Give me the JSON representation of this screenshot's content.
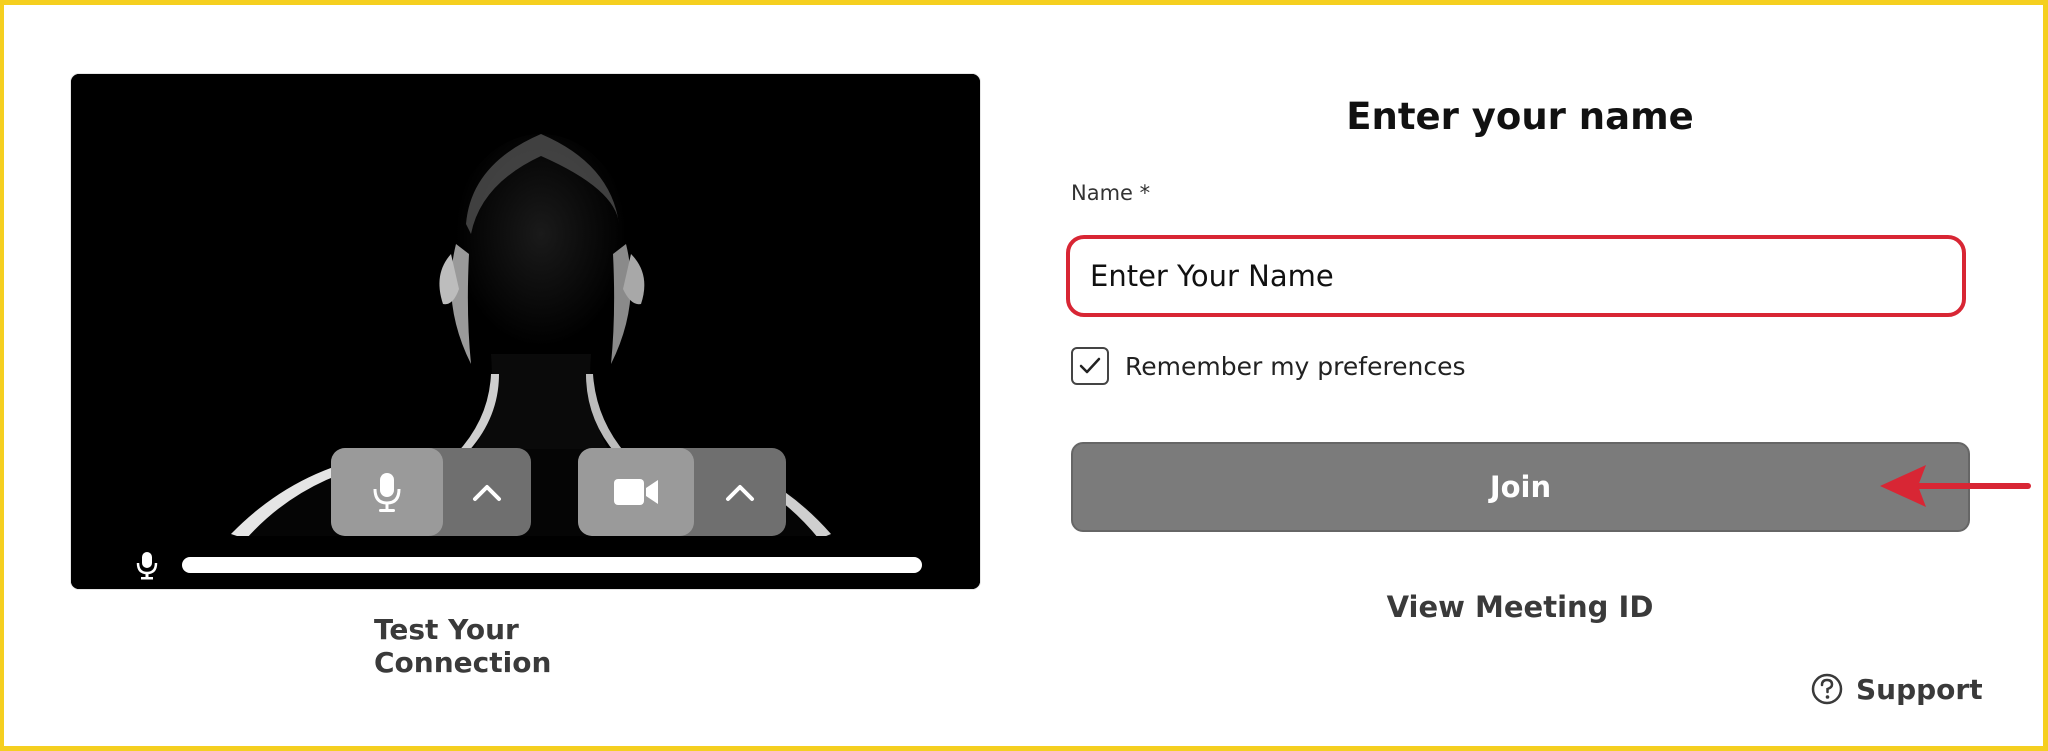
{
  "form": {
    "title": "Enter your name",
    "name_label": "Name *",
    "name_placeholder": "Enter Your Name",
    "remember_label": "Remember my preferences",
    "remember_checked": true,
    "join_label": "Join",
    "view_meeting_id": "View Meeting ID"
  },
  "preview": {
    "test_connection": "Test Your Connection",
    "mic_button_icon": "microphone-icon",
    "camera_button_icon": "video-camera-icon",
    "expand_icon": "chevron-up-icon"
  },
  "support": {
    "label": "Support",
    "icon": "help-circle-icon"
  },
  "colors": {
    "frame_border": "#f5cf1f",
    "input_highlight": "#d82634",
    "join_button": "#7b7b7b",
    "arrow": "#d82634"
  }
}
